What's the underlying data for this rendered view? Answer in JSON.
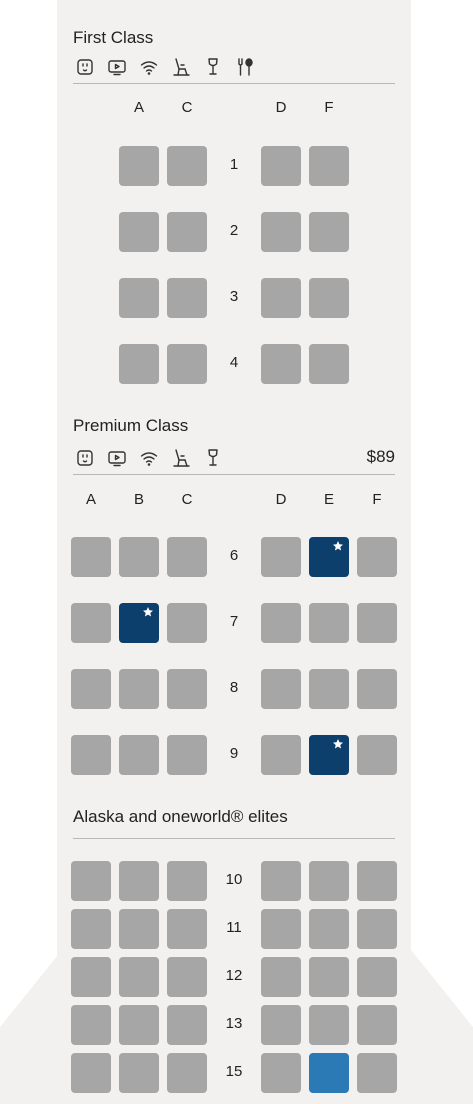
{
  "cabins": [
    {
      "title": "First Class",
      "amenities": [
        "power-outlet-icon",
        "tv-icon",
        "wifi-icon",
        "recline-seat-icon",
        "drink-icon",
        "dining-icon"
      ],
      "price": "",
      "columns": [
        "A",
        "C",
        "D",
        "F"
      ],
      "rows": [
        {
          "label": "1",
          "seats": [
            {
              "col": "A",
              "status": "unavailable"
            },
            {
              "col": "C",
              "status": "unavailable"
            },
            {
              "col": "D",
              "status": "unavailable"
            },
            {
              "col": "F",
              "status": "unavailable"
            }
          ]
        },
        {
          "label": "2",
          "seats": [
            {
              "col": "A",
              "status": "unavailable"
            },
            {
              "col": "C",
              "status": "unavailable"
            },
            {
              "col": "D",
              "status": "unavailable"
            },
            {
              "col": "F",
              "status": "unavailable"
            }
          ]
        },
        {
          "label": "3",
          "seats": [
            {
              "col": "A",
              "status": "unavailable"
            },
            {
              "col": "C",
              "status": "unavailable"
            },
            {
              "col": "D",
              "status": "unavailable"
            },
            {
              "col": "F",
              "status": "unavailable"
            }
          ]
        },
        {
          "label": "4",
          "seats": [
            {
              "col": "A",
              "status": "unavailable"
            },
            {
              "col": "C",
              "status": "unavailable"
            },
            {
              "col": "D",
              "status": "unavailable"
            },
            {
              "col": "F",
              "status": "unavailable"
            }
          ]
        }
      ]
    },
    {
      "title": "Premium Class",
      "amenities": [
        "power-outlet-icon",
        "tv-icon",
        "wifi-icon",
        "recline-seat-icon",
        "drink-icon"
      ],
      "price": "$89",
      "columns": [
        "A",
        "B",
        "C",
        "D",
        "E",
        "F"
      ],
      "rows": [
        {
          "label": "6",
          "seats": [
            {
              "col": "A",
              "status": "unavailable"
            },
            {
              "col": "B",
              "status": "unavailable"
            },
            {
              "col": "C",
              "status": "unavailable"
            },
            {
              "col": "D",
              "status": "unavailable"
            },
            {
              "col": "E",
              "status": "preferred-star"
            },
            {
              "col": "F",
              "status": "unavailable"
            }
          ]
        },
        {
          "label": "7",
          "seats": [
            {
              "col": "A",
              "status": "unavailable"
            },
            {
              "col": "B",
              "status": "preferred-star"
            },
            {
              "col": "C",
              "status": "unavailable"
            },
            {
              "col": "D",
              "status": "unavailable"
            },
            {
              "col": "E",
              "status": "unavailable"
            },
            {
              "col": "F",
              "status": "unavailable"
            }
          ]
        },
        {
          "label": "8",
          "seats": [
            {
              "col": "A",
              "status": "unavailable"
            },
            {
              "col": "B",
              "status": "unavailable"
            },
            {
              "col": "C",
              "status": "unavailable"
            },
            {
              "col": "D",
              "status": "unavailable"
            },
            {
              "col": "E",
              "status": "unavailable"
            },
            {
              "col": "F",
              "status": "unavailable"
            }
          ]
        },
        {
          "label": "9",
          "seats": [
            {
              "col": "A",
              "status": "unavailable"
            },
            {
              "col": "B",
              "status": "unavailable"
            },
            {
              "col": "C",
              "status": "unavailable"
            },
            {
              "col": "D",
              "status": "unavailable"
            },
            {
              "col": "E",
              "status": "preferred-star"
            },
            {
              "col": "F",
              "status": "unavailable"
            }
          ]
        }
      ]
    },
    {
      "title": "Alaska and oneworld® elites",
      "amenities": [],
      "price": "",
      "columns": [],
      "rows": [
        {
          "label": "10",
          "seats": [
            {
              "col": "A",
              "status": "unavailable"
            },
            {
              "col": "B",
              "status": "unavailable"
            },
            {
              "col": "C",
              "status": "unavailable"
            },
            {
              "col": "D",
              "status": "unavailable"
            },
            {
              "col": "E",
              "status": "unavailable"
            },
            {
              "col": "F",
              "status": "unavailable"
            }
          ]
        },
        {
          "label": "11",
          "seats": [
            {
              "col": "A",
              "status": "unavailable"
            },
            {
              "col": "B",
              "status": "unavailable"
            },
            {
              "col": "C",
              "status": "unavailable"
            },
            {
              "col": "D",
              "status": "unavailable"
            },
            {
              "col": "E",
              "status": "unavailable"
            },
            {
              "col": "F",
              "status": "unavailable"
            }
          ]
        },
        {
          "label": "12",
          "seats": [
            {
              "col": "A",
              "status": "unavailable"
            },
            {
              "col": "B",
              "status": "unavailable"
            },
            {
              "col": "C",
              "status": "unavailable"
            },
            {
              "col": "D",
              "status": "unavailable"
            },
            {
              "col": "E",
              "status": "unavailable"
            },
            {
              "col": "F",
              "status": "unavailable"
            }
          ]
        },
        {
          "label": "13",
          "seats": [
            {
              "col": "A",
              "status": "unavailable"
            },
            {
              "col": "B",
              "status": "unavailable"
            },
            {
              "col": "C",
              "status": "unavailable"
            },
            {
              "col": "D",
              "status": "unavailable"
            },
            {
              "col": "E",
              "status": "unavailable"
            },
            {
              "col": "F",
              "status": "unavailable"
            }
          ]
        },
        {
          "label": "15",
          "seats": [
            {
              "col": "A",
              "status": "unavailable"
            },
            {
              "col": "B",
              "status": "unavailable"
            },
            {
              "col": "C",
              "status": "unavailable"
            },
            {
              "col": "D",
              "status": "unavailable"
            },
            {
              "col": "E",
              "status": "available-highlight"
            },
            {
              "col": "F",
              "status": "unavailable"
            }
          ]
        }
      ]
    }
  ],
  "colors": {
    "fuselage": "#f2f1ef",
    "seat_unavailable": "#a6a6a6",
    "seat_preferred": "#0c3f6b",
    "seat_highlight": "#2b79b5"
  }
}
